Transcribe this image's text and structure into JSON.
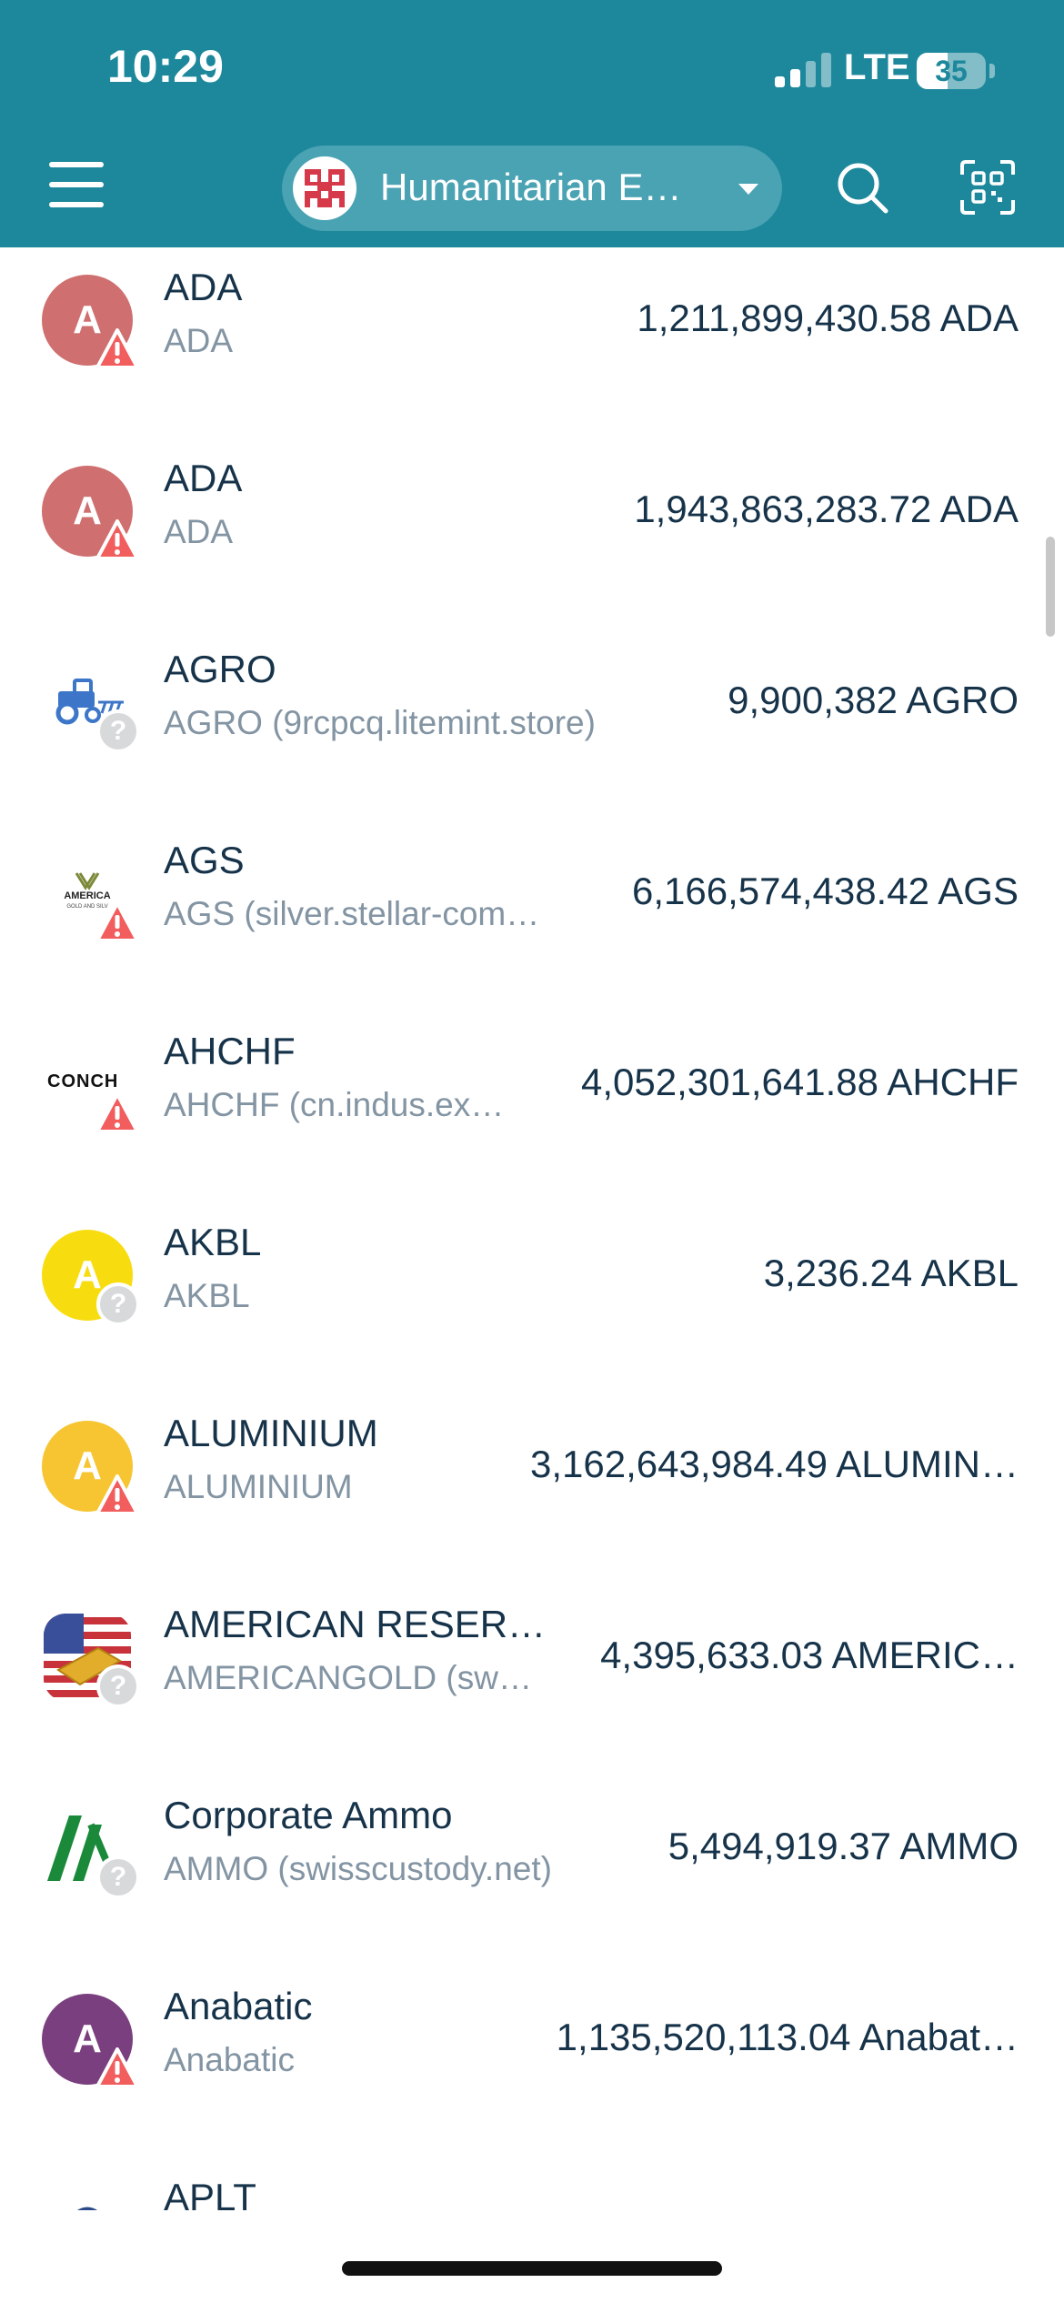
{
  "status_bar": {
    "time": "10:29",
    "network": "LTE",
    "battery": "35"
  },
  "header": {
    "account_name": "Humanitarian E…"
  },
  "colors": {
    "header_bg": "#1d889c",
    "warning": "#f25d5d",
    "text": "#16334a",
    "muted": "#8394a3"
  },
  "assets": [
    {
      "name": "ADA",
      "sub": "ADA",
      "balance": "1,211,899,430.58 ADA",
      "icon": "letter",
      "letter": "A",
      "icon_color": "#cf6f6f",
      "badge": "warning"
    },
    {
      "name": "ADA",
      "sub": "ADA",
      "balance": "1,943,863,283.72 ADA",
      "icon": "letter",
      "letter": "A",
      "icon_color": "#cf6f6f",
      "badge": "warning"
    },
    {
      "name": "AGRO",
      "sub": "AGRO (9rcpcq.litemint.store)",
      "balance": "9,900,382 AGRO",
      "icon": "tractor-icon",
      "badge": "unknown"
    },
    {
      "name": "AGS",
      "sub": "AGS (silver.stellar-com…",
      "balance": "6,166,574,438.42 AGS",
      "icon": "america-logo-icon",
      "badge": "warning"
    },
    {
      "name": "AHCHF",
      "sub": "AHCHF (cn.indus.ex…",
      "balance": "4,052,301,641.88 AHCHF",
      "icon": "conch-logo-icon",
      "logo_text": "CONCH",
      "badge": "warning"
    },
    {
      "name": "AKBL",
      "sub": "AKBL",
      "balance": "3,236.24 AKBL",
      "icon": "letter",
      "letter": "A",
      "icon_color": "#f7dd10",
      "badge": "unknown"
    },
    {
      "name": "ALUMINIUM",
      "sub": "ALUMINIUM",
      "balance": "3,162,643,984.49 ALUMIN…",
      "icon": "letter",
      "letter": "A",
      "icon_color": "#f6c531",
      "badge": "warning"
    },
    {
      "name": "AMERICAN RESER…",
      "sub": "AMERICANGOLD (sw…",
      "balance": "4,395,633.03 AMERIC…",
      "icon": "us-flag-gold-icon",
      "badge": "unknown"
    },
    {
      "name": "Corporate Ammo",
      "sub": "AMMO (swisscustody.net)",
      "balance": "5,494,919.37 AMMO",
      "icon": "ammo-logo-icon",
      "badge": "unknown"
    },
    {
      "name": "Anabatic",
      "sub": "Anabatic",
      "balance": "1,135,520,113.04 Anabat…",
      "icon": "letter",
      "letter": "A",
      "icon_color": "#7a3f7e",
      "badge": "warning"
    },
    {
      "name": "APLT",
      "sub": "",
      "balance": "",
      "icon": "aplt-logo-icon",
      "badge": "none"
    }
  ]
}
